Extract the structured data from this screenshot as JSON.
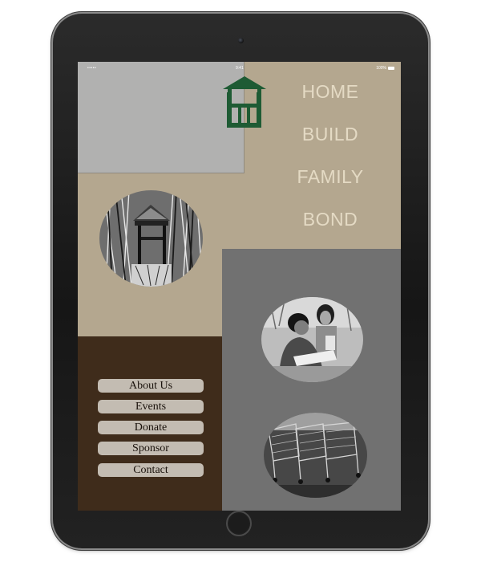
{
  "status_bar": {
    "signal": "•••••",
    "time": "9:41",
    "battery": "100%"
  },
  "nav": {
    "items": [
      {
        "label": "HOME"
      },
      {
        "label": "BUILD"
      },
      {
        "label": "FAMILY"
      },
      {
        "label": "BOND"
      }
    ]
  },
  "menu": {
    "items": [
      {
        "label": "About Us"
      },
      {
        "label": "Events"
      },
      {
        "label": "Donate"
      },
      {
        "label": "Sponsor"
      },
      {
        "label": "Contact"
      }
    ]
  },
  "colors": {
    "screen_background": "#b4a78f",
    "header_panel": "#b1b1b0",
    "dark_panel": "#717171",
    "menu_panel": "#3f2c1b",
    "logo_green": "#1e5b34",
    "nav_text": "#e4dac4",
    "menu_button": "#c3bcb2"
  },
  "photos": [
    {
      "subject": "hut-among-reeds"
    },
    {
      "subject": "two-women-with-papers"
    },
    {
      "subject": "shopping-carts"
    }
  ]
}
